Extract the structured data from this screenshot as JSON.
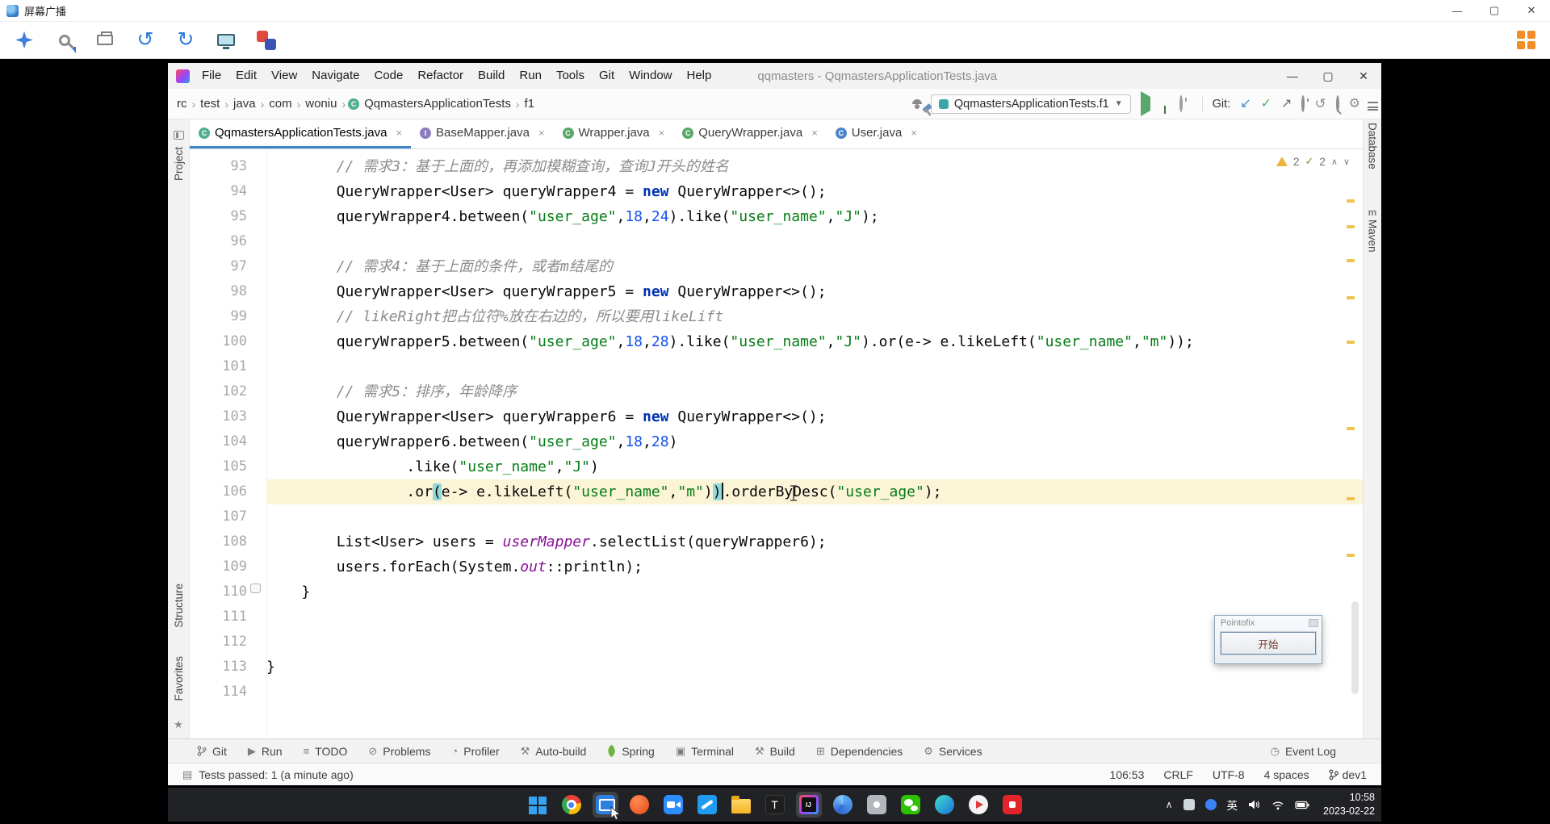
{
  "colors": {
    "tab_underline": "#4083C9",
    "caret_row": "#FBF4D7",
    "keyword": "#0033B3",
    "string": "#067D17",
    "number": "#1750EB",
    "comment": "#8C8C8C",
    "field": "#871094",
    "brace_match": "#93D9D9",
    "stripe_mark": "#F0C34E",
    "fullscreen_icon": "#F28C28"
  },
  "broadcast": {
    "window_title": "屏幕广播",
    "toolbar_icons": [
      "pointer-star",
      "zoom-edit",
      "print",
      "undo",
      "redo",
      "monitor",
      "marker",
      "fullscreen"
    ]
  },
  "ide": {
    "title": "qqmasters - QqmastersApplicationTests.java",
    "menus": [
      "File",
      "Edit",
      "View",
      "Navigate",
      "Code",
      "Refactor",
      "Build",
      "Run",
      "Tools",
      "Git",
      "Window",
      "Help"
    ],
    "breadcrumbs": [
      {
        "label": "rc"
      },
      {
        "label": "test"
      },
      {
        "label": "java"
      },
      {
        "label": "com"
      },
      {
        "label": "woniu"
      },
      {
        "label": "QqmastersApplicationTests",
        "icon": "test-class"
      },
      {
        "label": "f1"
      }
    ],
    "run_config_label": "QqmastersApplicationTests.f1",
    "git_label": "Git:",
    "tabs": [
      {
        "label": "QqmastersApplicationTests.java",
        "icon": "test",
        "active": true
      },
      {
        "label": "BaseMapper.java",
        "icon": "intf",
        "active": false
      },
      {
        "label": "Wrapper.java",
        "icon": "clsg",
        "active": false
      },
      {
        "label": "QueryWrapper.java",
        "icon": "clsg",
        "active": false
      },
      {
        "label": "User.java",
        "icon": "clsb",
        "active": false
      }
    ],
    "left_stripe": {
      "project": "Project",
      "structure": "Structure",
      "favorites": "Favorites"
    },
    "right_stripe": {
      "database": "Database",
      "maven": "Maven"
    },
    "inspections": {
      "warnings": "2",
      "typos": "2"
    },
    "editor": {
      "stripe_marks": [
        62,
        94,
        136,
        182,
        237,
        344,
        431,
        501
      ],
      "lines": [
        {
          "n": "93",
          "ind": 8,
          "seg": [
            [
              "c",
              "// 需求3：基于上面的，再添加模糊查询，查询J开头的姓名"
            ]
          ]
        },
        {
          "n": "94",
          "ind": 8,
          "seg": [
            [
              "p",
              "QueryWrapper<User> queryWrapper4 = "
            ],
            [
              "k",
              "new"
            ],
            [
              "p",
              " QueryWrapper<>();"
            ]
          ]
        },
        {
          "n": "95",
          "ind": 8,
          "seg": [
            [
              "p",
              "queryWrapper4.between("
            ],
            [
              "s",
              "\"user_age\""
            ],
            [
              "p",
              ","
            ],
            [
              "n",
              "18"
            ],
            [
              "p",
              ","
            ],
            [
              "n",
              "24"
            ],
            [
              "p",
              ").like("
            ],
            [
              "s",
              "\"user_name\""
            ],
            [
              "p",
              ","
            ],
            [
              "s",
              "\"J\""
            ],
            [
              "p",
              ");"
            ]
          ]
        },
        {
          "n": "96",
          "ind": 0,
          "seg": []
        },
        {
          "n": "97",
          "ind": 8,
          "seg": [
            [
              "c",
              "// 需求4：基于上面的条件，或者m结尾的"
            ]
          ]
        },
        {
          "n": "98",
          "ind": 8,
          "seg": [
            [
              "p",
              "QueryWrapper<User> queryWrapper5 = "
            ],
            [
              "k",
              "new"
            ],
            [
              "p",
              " QueryWrapper<>();"
            ]
          ]
        },
        {
          "n": "99",
          "ind": 8,
          "seg": [
            [
              "c",
              "// likeRight把占位符%放在右边的，所以要用likeLift"
            ]
          ]
        },
        {
          "n": "100",
          "ind": 8,
          "seg": [
            [
              "p",
              "queryWrapper5.between("
            ],
            [
              "s",
              "\"user_age\""
            ],
            [
              "p",
              ","
            ],
            [
              "n",
              "18"
            ],
            [
              "p",
              ","
            ],
            [
              "n",
              "28"
            ],
            [
              "p",
              ").like("
            ],
            [
              "s",
              "\"user_name\""
            ],
            [
              "p",
              ","
            ],
            [
              "s",
              "\"J\""
            ],
            [
              "p",
              ").or(e-> e.likeLeft("
            ],
            [
              "s",
              "\"user_name\""
            ],
            [
              "p",
              ","
            ],
            [
              "s",
              "\"m\""
            ],
            [
              "p",
              "));"
            ]
          ]
        },
        {
          "n": "101",
          "ind": 0,
          "seg": []
        },
        {
          "n": "102",
          "ind": 8,
          "seg": [
            [
              "c",
              "// 需求5：排序，年龄降序"
            ]
          ]
        },
        {
          "n": "103",
          "ind": 8,
          "seg": [
            [
              "p",
              "QueryWrapper<User> queryWrapper6 = "
            ],
            [
              "k",
              "new"
            ],
            [
              "p",
              " QueryWrapper<>();"
            ]
          ]
        },
        {
          "n": "104",
          "ind": 8,
          "seg": [
            [
              "p",
              "queryWrapper6.between("
            ],
            [
              "s",
              "\"user_age\""
            ],
            [
              "p",
              ","
            ],
            [
              "n",
              "18"
            ],
            [
              "p",
              ","
            ],
            [
              "n",
              "28"
            ],
            [
              "p",
              ")"
            ]
          ]
        },
        {
          "n": "105",
          "ind": 16,
          "seg": [
            [
              "p",
              ".like("
            ],
            [
              "s",
              "\"user_name\""
            ],
            [
              "p",
              ","
            ],
            [
              "s",
              "\"J\""
            ],
            [
              "p",
              ")"
            ]
          ]
        },
        {
          "n": "106",
          "ind": 16,
          "cur": true,
          "seg": [
            [
              "p",
              ".or"
            ],
            [
              "m",
              "("
            ],
            [
              "p",
              "e-> e.likeLeft("
            ],
            [
              "s",
              "\"user_name\""
            ],
            [
              "p",
              ","
            ],
            [
              "s",
              "\"m\""
            ],
            [
              "p",
              ")"
            ],
            [
              "m",
              ")"
            ],
            [
              "caret",
              ""
            ],
            [
              "p",
              ".orderByDesc("
            ],
            [
              "s",
              "\"user_age\""
            ],
            [
              "p",
              ");"
            ]
          ]
        },
        {
          "n": "107",
          "ind": 0,
          "seg": []
        },
        {
          "n": "108",
          "ind": 8,
          "seg": [
            [
              "p",
              "List<User> users = "
            ],
            [
              "f",
              "userMapper"
            ],
            [
              "p",
              ".selectList(queryWrapper6);"
            ]
          ]
        },
        {
          "n": "109",
          "ind": 8,
          "seg": [
            [
              "p",
              "users.forEach(System."
            ],
            [
              "f",
              "out"
            ],
            [
              "p",
              "::println);"
            ]
          ]
        },
        {
          "n": "110",
          "ind": 4,
          "seg": [
            [
              "p",
              "}"
            ]
          ]
        },
        {
          "n": "111",
          "ind": 0,
          "seg": []
        },
        {
          "n": "112",
          "ind": 0,
          "seg": []
        },
        {
          "n": "113",
          "ind": 0,
          "seg": [
            [
              "p",
              "}"
            ]
          ]
        },
        {
          "n": "114",
          "ind": 0,
          "seg": []
        }
      ]
    },
    "tool_buttons": [
      {
        "label": "Git",
        "icon": "git-branch-icon"
      },
      {
        "label": "Run",
        "icon": "run-icon"
      },
      {
        "label": "TODO",
        "icon": "todo-icon"
      },
      {
        "label": "Problems",
        "icon": "problems-icon"
      },
      {
        "label": "Profiler",
        "icon": "profiler-icon"
      },
      {
        "label": "Auto-build",
        "icon": "auto-build-icon"
      },
      {
        "label": "Spring",
        "icon": "spring-icon"
      },
      {
        "label": "Terminal",
        "icon": "terminal-icon"
      },
      {
        "label": "Build",
        "icon": "build-icon"
      },
      {
        "label": "Dependencies",
        "icon": "dependencies-icon"
      },
      {
        "label": "Services",
        "icon": "services-icon"
      }
    ],
    "event_log_label": "Event Log",
    "status": {
      "message": "Tests passed: 1 (a minute ago)",
      "caret_position": "106:53",
      "line_ending": "CRLF",
      "encoding": "UTF-8",
      "indent": "4 spaces",
      "branch": "dev1"
    }
  },
  "pointofix": {
    "title": "Pointofix",
    "start_button": "开始"
  },
  "taskbar": {
    "icons": [
      {
        "name": "windows-start"
      },
      {
        "name": "chrome"
      },
      {
        "name": "screen-broadcast",
        "active": true,
        "cursor": true
      },
      {
        "name": "app-orange"
      },
      {
        "name": "tencent-meeting"
      },
      {
        "name": "vscode"
      },
      {
        "name": "file-explorer"
      },
      {
        "name": "typora"
      },
      {
        "name": "intellij-idea",
        "active": true
      },
      {
        "name": "browser-2"
      },
      {
        "name": "app-gray"
      },
      {
        "name": "wechat"
      },
      {
        "name": "edge"
      },
      {
        "name": "media-player"
      },
      {
        "name": "youdao"
      }
    ],
    "input_method": "英",
    "time": "10:58",
    "date": "2023-02-22"
  }
}
